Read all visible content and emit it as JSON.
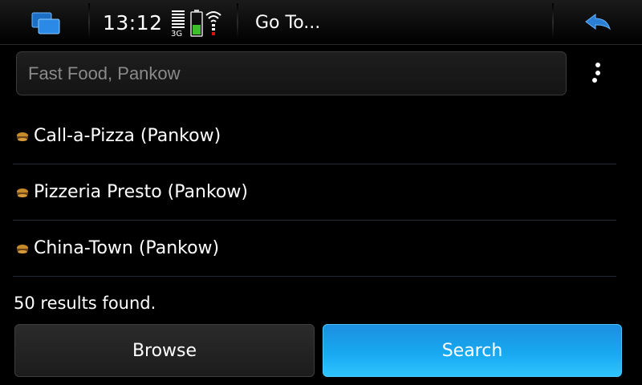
{
  "status_bar": {
    "time": "13:12",
    "network": "3G",
    "title": "Go To..."
  },
  "search": {
    "placeholder": "Fast Food, Pankow"
  },
  "results": [
    {
      "label": "Call-a-Pizza (Pankow)"
    },
    {
      "label": "Pizzeria Presto (Pankow)"
    },
    {
      "label": "China-Town (Pankow)"
    }
  ],
  "results_count_text": "50 results found.",
  "buttons": {
    "browse": "Browse",
    "search": "Search"
  },
  "colors": {
    "accent": "#1ba3ee",
    "back_arrow": "#2a7fd4"
  },
  "icons": [
    "task-switcher-icon",
    "signal-icon",
    "battery-icon",
    "wifi-icon",
    "back-icon",
    "menu-icon",
    "food-icon"
  ]
}
